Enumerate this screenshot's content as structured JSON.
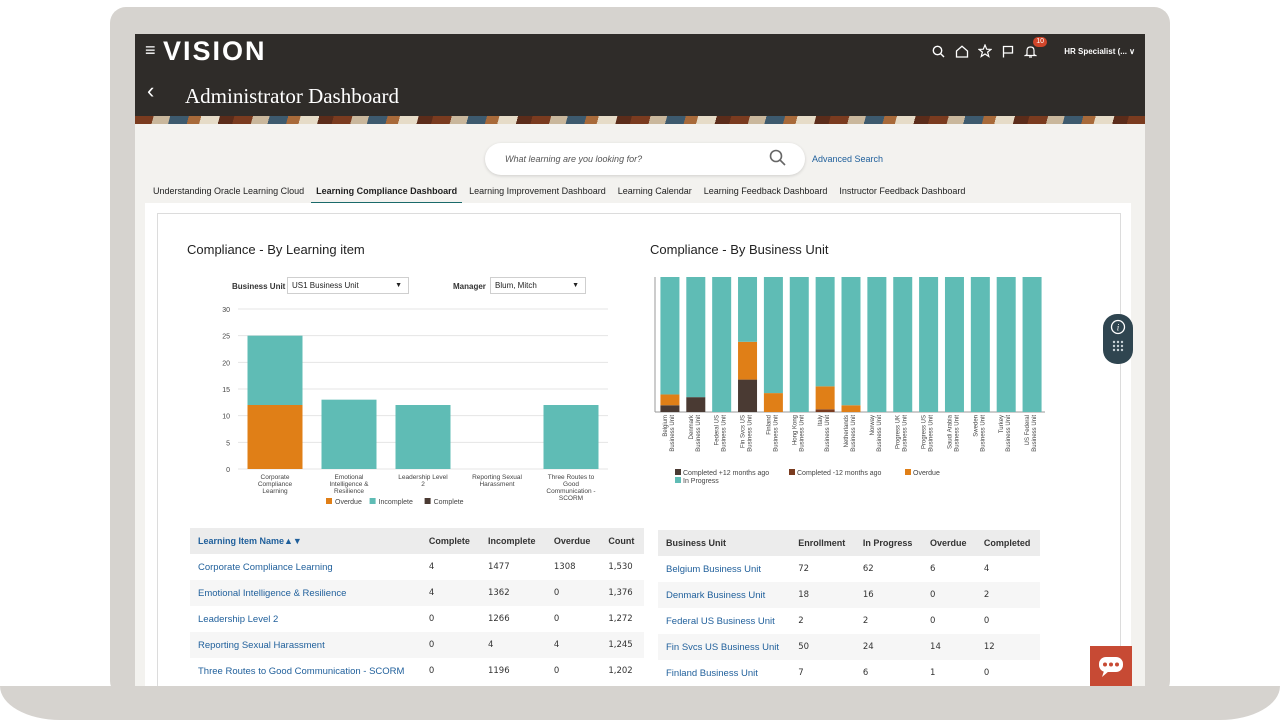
{
  "app": {
    "logo": "VISION",
    "menu_icon": "hamburger-icon",
    "page_title": "Administrator Dashboard"
  },
  "header": {
    "notifications_count": "10",
    "user_label": "HR Specialist (... ∨",
    "icons": [
      "search-icon",
      "home-icon",
      "star-icon",
      "flag-icon",
      "bell-icon"
    ]
  },
  "search": {
    "placeholder": "What learning are you looking for?",
    "advanced_label": "Advanced Search"
  },
  "tabs": [
    {
      "label": "Understanding Oracle Learning Cloud",
      "active": false
    },
    {
      "label": "Learning Compliance Dashboard",
      "active": true
    },
    {
      "label": "Learning Improvement Dashboard",
      "active": false
    },
    {
      "label": "Learning Calendar",
      "active": false
    },
    {
      "label": "Learning Feedback Dashboard",
      "active": false
    },
    {
      "label": "Instructor Feedback Dashboard",
      "active": false
    }
  ],
  "left": {
    "title": "Compliance - By Learning item",
    "business_unit_label": "Business Unit",
    "business_unit_value": "US1 Business Unit",
    "manager_label": "Manager",
    "manager_value": "Blum, Mitch"
  },
  "right": {
    "title": "Compliance - By Business Unit"
  },
  "chart_data": [
    {
      "type": "bar",
      "stacked": true,
      "categories": [
        "Corporate Compliance Learning",
        "Emotional Intelligence & Resilience",
        "Leadership Level 2",
        "Reporting Sexual Harassment",
        "Three Routes to Good Communication - SCORM"
      ],
      "series": [
        {
          "name": "Overdue",
          "values": [
            12,
            0,
            0,
            0,
            0
          ]
        },
        {
          "name": "Incomplete",
          "values": [
            13,
            13,
            12,
            0,
            12
          ]
        },
        {
          "name": "Complete",
          "values": [
            0,
            0,
            0,
            0,
            0
          ]
        }
      ],
      "ylim": [
        0,
        30
      ],
      "yticks": [
        0,
        5,
        10,
        15,
        20,
        25,
        30
      ],
      "grid": true,
      "legend": "bottom",
      "colors": {
        "Overdue": "#e07f17",
        "Incomplete": "#5fbcb5",
        "Complete": "#4a3a33"
      }
    },
    {
      "type": "bar",
      "stacked": true,
      "percent": true,
      "categories": [
        "Belgium Business Unit",
        "Denmark Business Unit",
        "Federal US Business Unit",
        "Fin Svcs US Business Unit",
        "Finland Business Unit",
        "Hong Kong Business Unit",
        "Italy Business Unit",
        "Netherlands Business Unit",
        "Norway Business Unit",
        "Progress UK Business Unit",
        "Progress US Business Unit",
        "Saudi Arabia Business Unit",
        "Sweden Business Unit",
        "Turkey Business Unit",
        "US Federal Business Unit"
      ],
      "series": [
        {
          "name": "Completed +12 months ago",
          "values": [
            5,
            11,
            0,
            24,
            0,
            0,
            0,
            0,
            0,
            0,
            0,
            0,
            0,
            0,
            0
          ]
        },
        {
          "name": "Completed -12 months ago",
          "values": [
            0,
            0,
            0,
            0,
            0,
            0,
            2,
            0,
            0,
            0,
            0,
            0,
            0,
            0,
            0
          ]
        },
        {
          "name": "Overdue",
          "values": [
            8,
            0,
            0,
            28,
            14,
            0,
            17,
            5,
            0,
            0,
            0,
            0,
            0,
            0,
            0
          ]
        },
        {
          "name": "In Progress",
          "values": [
            87,
            89,
            100,
            48,
            86,
            100,
            81,
            95,
            100,
            100,
            100,
            100,
            100,
            100,
            100
          ]
        }
      ],
      "ylim": [
        0,
        100
      ],
      "legend": "bottom",
      "colors": {
        "Completed +12 months ago": "#4a3a33",
        "Completed -12 months ago": "#7a3b1f",
        "Overdue": "#e07f17",
        "In Progress": "#5fbcb5"
      }
    }
  ],
  "learning_table": {
    "headers": [
      "Learning Item Name▲▼",
      "Complete",
      "Incomplete",
      "Overdue",
      "Count"
    ],
    "rows": [
      [
        "Corporate Compliance Learning",
        "4",
        "1477",
        "1308",
        "1,530"
      ],
      [
        "Emotional Intelligence & Resilience",
        "4",
        "1362",
        "0",
        "1,376"
      ],
      [
        "Leadership Level 2",
        "0",
        "1266",
        "0",
        "1,272"
      ],
      [
        "Reporting Sexual Harassment",
        "0",
        "4",
        "4",
        "1,245"
      ],
      [
        "Three Routes to Good Communication - SCORM",
        "0",
        "1196",
        "0",
        "1,202"
      ]
    ]
  },
  "bu_table": {
    "headers": [
      "Business Unit",
      "Enrollment",
      "In Progress",
      "Overdue",
      "Completed"
    ],
    "rows": [
      [
        "Belgium Business Unit",
        "72",
        "62",
        "6",
        "4"
      ],
      [
        "Denmark Business Unit",
        "18",
        "16",
        "0",
        "2"
      ],
      [
        "Federal US Business Unit",
        "2",
        "2",
        "0",
        "0"
      ],
      [
        "Fin Svcs US Business Unit",
        "50",
        "24",
        "14",
        "12"
      ],
      [
        "Finland Business Unit",
        "7",
        "6",
        "1",
        "0"
      ]
    ]
  }
}
